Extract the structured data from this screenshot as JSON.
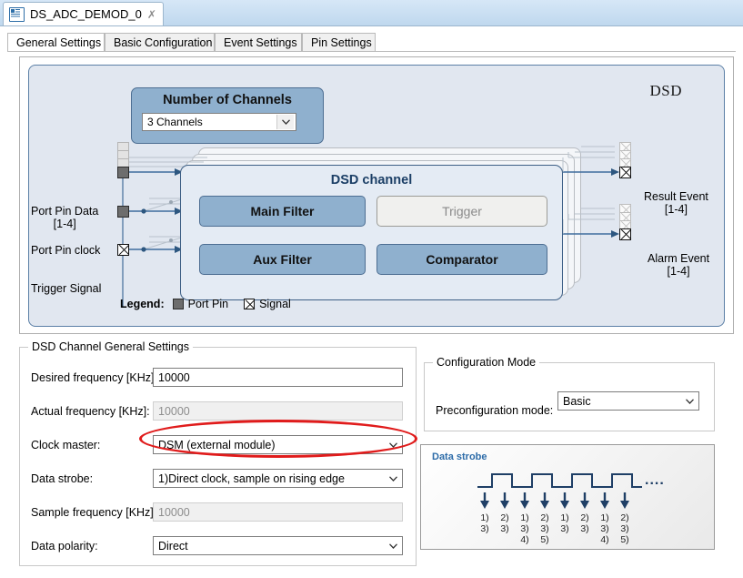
{
  "editor_tab": {
    "title": "DS_ADC_DEMOD_0",
    "close_label": "✗",
    "icon": "document-icon"
  },
  "tabs": [
    {
      "label": "General Settings",
      "active": true
    },
    {
      "label": "Basic Configuration",
      "active": false
    },
    {
      "label": "Event Settings",
      "active": false
    },
    {
      "label": "Pin Settings",
      "active": false
    }
  ],
  "diagram": {
    "module_label": "DSD",
    "number_of_channels": {
      "title": "Number of Channels",
      "value": "3 Channels",
      "caret": "⌄"
    },
    "channel": {
      "title": "DSD channel",
      "blocks": [
        {
          "label": "Main Filter",
          "enabled": true
        },
        {
          "label": "Trigger",
          "enabled": false
        },
        {
          "label": "Aux Filter",
          "enabled": true
        },
        {
          "label": "Comparator",
          "enabled": true
        }
      ]
    },
    "inputs": [
      {
        "label": "Port Pin Data",
        "sub": "[1-4]",
        "kind": "port-pin"
      },
      {
        "label": "Port Pin clock",
        "sub": "",
        "kind": "port-pin"
      },
      {
        "label": "Trigger Signal",
        "sub": "",
        "kind": "signal"
      }
    ],
    "outputs": [
      {
        "label": "Result Event",
        "sub": "[1-4]",
        "kind": "signal"
      },
      {
        "label": "Alarm Event",
        "sub": "[1-4]",
        "kind": "signal"
      }
    ],
    "legend": {
      "title": "Legend:",
      "items": [
        {
          "label": "Port Pin",
          "kind": "port-pin"
        },
        {
          "label": "Signal",
          "kind": "signal"
        }
      ]
    }
  },
  "general_settings": {
    "title": "DSD Channel General Settings",
    "fields": [
      {
        "label": "Desired frequency [KHz]:",
        "value": "10000",
        "type": "text",
        "readonly": false
      },
      {
        "label": "Actual frequency [KHz]:",
        "value": "10000",
        "type": "text",
        "readonly": true
      },
      {
        "label": "Clock master:",
        "value": "DSM (external module)",
        "type": "combo",
        "readonly": false,
        "highlighted": true
      },
      {
        "label": "Data strobe:",
        "value": "1)Direct clock, sample on rising edge",
        "type": "combo",
        "readonly": false
      },
      {
        "label": "Sample frequency [KHz]:",
        "value": "10000",
        "type": "text",
        "readonly": true
      },
      {
        "label": "Data polarity:",
        "value": "Direct",
        "type": "combo",
        "readonly": false
      }
    ],
    "caret": "⌄"
  },
  "configuration_mode": {
    "title": "Configuration Mode",
    "field": {
      "label": "Preconfiguration mode:",
      "value": "Basic",
      "caret": "⌄"
    }
  },
  "waveform": {
    "title": "Data strobe",
    "ellipsis": "....",
    "columns": [
      [
        "1)",
        "3)"
      ],
      [
        "2)",
        "3)"
      ],
      [
        "1)",
        "3)",
        "4)"
      ],
      [
        "2)",
        "3)",
        "5)"
      ],
      [
        "1)",
        "3)"
      ],
      [
        "2)",
        "3)"
      ],
      [
        "1)",
        "3)",
        "4)"
      ],
      [
        "2)",
        "3)",
        "5)"
      ]
    ]
  },
  "colors": {
    "accent_blue": "#8fb0ce",
    "panel_bg": "#e1e7f0",
    "channel_bg": "#e4ebf4",
    "border_blue": "#3d5f85",
    "annotation_red": "#e01b1b",
    "wire_blue": "#3f6d9e"
  }
}
